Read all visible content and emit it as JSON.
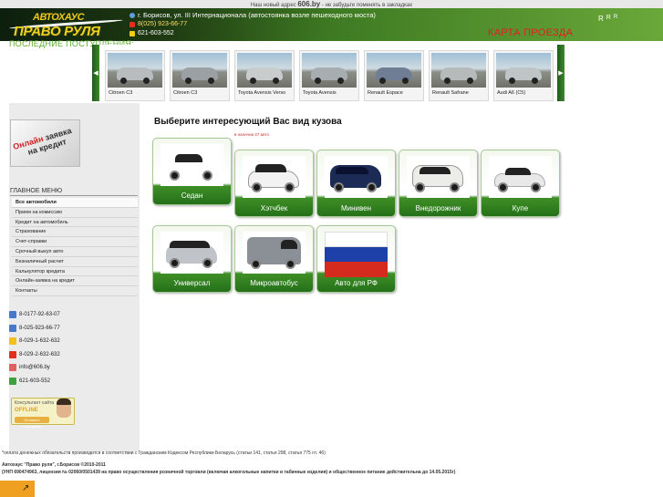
{
  "topbar": {
    "prefix": "Наш новый адрес",
    "domain": "606.by",
    "suffix": "- не забудьте поменять в закладках"
  },
  "logo": {
    "line1": "АВТОХАУС",
    "line2": "ПРАВО РУЛЯ"
  },
  "contacts": {
    "address": "г. Борисов, ул. III Интернационала (автостоянка возле пешеходного моста)",
    "phone1": "8(025) 923-66-77",
    "phone2": "621-603-552"
  },
  "lang": [
    "R",
    "R",
    "R"
  ],
  "karta": "КАРТА ПРОЕЗДА",
  "recent": {
    "title": "ПОСЛЕДНИЕ ПОСТУПЛЕНИЯ:",
    "items": [
      {
        "label": "Citroen C3",
        "color": "#b9bcbf"
      },
      {
        "label": "Citroen C3",
        "color": "#9aa0a4"
      },
      {
        "label": "Toyota Avensis Verso",
        "color": "#c9cccd"
      },
      {
        "label": "Toyota Avensis",
        "color": "#a7adb0"
      },
      {
        "label": "Renault Espace",
        "color": "#6f7e94"
      },
      {
        "label": "Renault Safrane",
        "color": "#b7babb"
      },
      {
        "label": "Audi A6 (C5)",
        "color": "#bfc4c6"
      }
    ]
  },
  "banner": {
    "line1a": "Онлайн",
    "line1b": "заявка",
    "line2": "на кредит"
  },
  "menu": {
    "title": "ГЛАВНОЕ МЕНЮ",
    "items": [
      "Все автомобили",
      "Прием на комиссию",
      "Кредит на автомобиль",
      "Страхование",
      "Счет-справки",
      "Срочный выкуп авто",
      "Безналичный расчет",
      "Калькулятор кредита",
      "Онлайн-заявка на кредит",
      "Контакты"
    ]
  },
  "phones": [
    {
      "text": "8-0177-92-63-07",
      "color": "#4a78c8"
    },
    {
      "text": "8-025-923-66-77",
      "color": "#4a78c8"
    },
    {
      "text": "8-029-1-632-632",
      "color": "#f0c020"
    },
    {
      "text": "8-029-2-632-632",
      "color": "#e03020"
    },
    {
      "text": "info@606.by",
      "color": "#e06060"
    },
    {
      "text": "621-603-552",
      "color": "#40a040"
    }
  ],
  "consult": {
    "title": "Консультант сайта",
    "status": "OFFLINE",
    "btn": "Оставить сообщение"
  },
  "main": {
    "title": "Выберите интересующий Вас вид кузова",
    "note": "в наличии 27 авто"
  },
  "body_types": [
    {
      "label": "Седан",
      "color": "#ffffff"
    },
    {
      "label": "Хэтчбек",
      "color": "#f2f2f2"
    },
    {
      "label": "Минивен",
      "color": "#1c2b55"
    },
    {
      "label": "Внедорожник",
      "color": "#ecece8"
    },
    {
      "label": "Купе",
      "color": "#e8e8e8"
    },
    {
      "label": "Универсал",
      "color": "#c0c4c8"
    },
    {
      "label": "Микроавтобус",
      "color": "#8a9096"
    },
    {
      "label": "Авто для РФ",
      "color": "#ffffff"
    }
  ],
  "footer": {
    "line1": "*оплата денежных обязательств производится в соответствии с Гражданским Кодексом Республики Беларусь (статьи 141, статья 298, статья 775 гл. 46)",
    "line2": "Автохаус \"Право руля\", г.Борисов ©2010-2011",
    "line3": "(УНП 690474963, лицензия № 02060/0501439 на право осуществления розничной торговли (включая алкогольные напитки и табачные изделия) и общественное питание действительна до 14.05.2015г)"
  }
}
